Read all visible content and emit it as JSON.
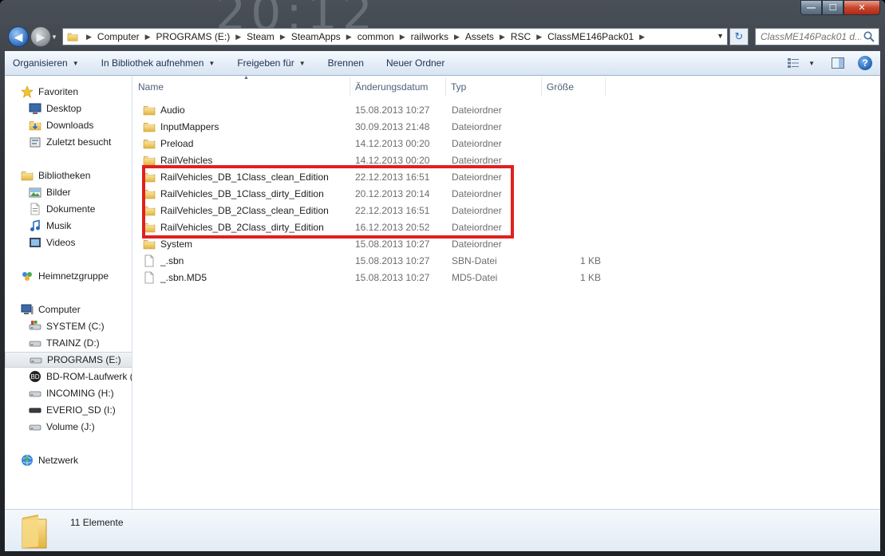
{
  "window": {
    "background_clock": "20:12",
    "buttons": {
      "minimize": "—",
      "maximize": "☐",
      "close": "✕"
    }
  },
  "address": {
    "crumbs": [
      "Computer",
      "PROGRAMS (E:)",
      "Steam",
      "SteamApps",
      "common",
      "railworks",
      "Assets",
      "RSC",
      "ClassME146Pack01"
    ]
  },
  "search": {
    "placeholder": "ClassME146Pack01 d..."
  },
  "toolbar": {
    "organize": "Organisieren",
    "library": "In Bibliothek aufnehmen",
    "share": "Freigeben für",
    "burn": "Brennen",
    "new_folder": "Neuer Ordner"
  },
  "sidebar": {
    "favorites": {
      "label": "Favoriten",
      "items": [
        "Desktop",
        "Downloads",
        "Zuletzt besucht"
      ]
    },
    "libraries": {
      "label": "Bibliotheken",
      "items": [
        "Bilder",
        "Dokumente",
        "Musik",
        "Videos"
      ]
    },
    "homegroup": {
      "label": "Heimnetzgruppe"
    },
    "computer": {
      "label": "Computer",
      "items": [
        "SYSTEM (C:)",
        "TRAINZ (D:)",
        "PROGRAMS (E:)",
        "BD-ROM-Laufwerk (",
        "INCOMING (H:)",
        "EVERIO_SD (I:)",
        "Volume (J:)"
      ],
      "selected": "PROGRAMS (E:)"
    },
    "network": {
      "label": "Netzwerk"
    }
  },
  "columns": {
    "name": "Name",
    "date": "Änderungsdatum",
    "type": "Typ",
    "size": "Größe"
  },
  "files": [
    {
      "name": "Audio",
      "date": "15.08.2013 10:27",
      "type": "Dateiordner",
      "size": "",
      "kind": "folder"
    },
    {
      "name": "InputMappers",
      "date": "30.09.2013 21:48",
      "type": "Dateiordner",
      "size": "",
      "kind": "folder"
    },
    {
      "name": "Preload",
      "date": "14.12.2013 00:20",
      "type": "Dateiordner",
      "size": "",
      "kind": "folder"
    },
    {
      "name": "RailVehicles",
      "date": "14.12.2013 00:20",
      "type": "Dateiordner",
      "size": "",
      "kind": "folder"
    },
    {
      "name": "RailVehicles_DB_1Class_clean_Edition",
      "date": "22.12.2013 16:51",
      "type": "Dateiordner",
      "size": "",
      "kind": "folder"
    },
    {
      "name": "RailVehicles_DB_1Class_dirty_Edition",
      "date": "20.12.2013 20:14",
      "type": "Dateiordner",
      "size": "",
      "kind": "folder"
    },
    {
      "name": "RailVehicles_DB_2Class_clean_Edition",
      "date": "22.12.2013 16:51",
      "type": "Dateiordner",
      "size": "",
      "kind": "folder"
    },
    {
      "name": "RailVehicles_DB_2Class_dirty_Edition",
      "date": "16.12.2013 20:52",
      "type": "Dateiordner",
      "size": "",
      "kind": "folder"
    },
    {
      "name": "System",
      "date": "15.08.2013 10:27",
      "type": "Dateiordner",
      "size": "",
      "kind": "folder"
    },
    {
      "name": "_.sbn",
      "date": "15.08.2013 10:27",
      "type": "SBN-Datei",
      "size": "1 KB",
      "kind": "file"
    },
    {
      "name": "_.sbn.MD5",
      "date": "15.08.2013 10:27",
      "type": "MD5-Datei",
      "size": "1 KB",
      "kind": "file"
    }
  ],
  "status": {
    "count": "11 Elemente"
  },
  "colors": {
    "highlight": "#e02020",
    "folder": "#f0c850",
    "accent": "#2a6cc0"
  }
}
